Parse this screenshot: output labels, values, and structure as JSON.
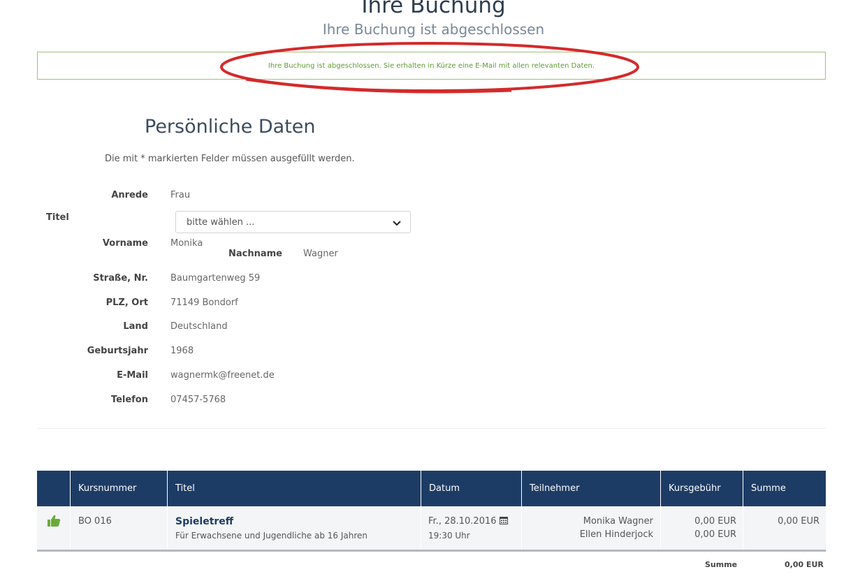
{
  "header": {
    "title": "Ihre Buchung",
    "subtitle": "Ihre Buchung ist abgeschlossen"
  },
  "alert": {
    "message": "Ihre Buchung ist abgeschlossen. Sie erhalten in Kürze eine E-Mail mit allen relevanten Daten."
  },
  "personal": {
    "section_title": "Persönliche Daten",
    "hint": "Die mit * markierten Felder müssen ausgefüllt werden.",
    "anrede_label": "Anrede",
    "anrede_value": "Frau",
    "titel_label": "Titel",
    "titel_select": "bitte wählen ...",
    "vorname_label": "Vorname",
    "vorname_value": "Monika",
    "nachname_label": "Nachname",
    "nachname_value": "Wagner",
    "strasse_label": "Straße, Nr.",
    "strasse_value": "Baumgartenweg 59",
    "plz_label": "PLZ, Ort",
    "plz_value": "71149 Bondorf",
    "land_label": "Land",
    "land_value": "Deutschland",
    "geburtsjahr_label": "Geburtsjahr",
    "geburtsjahr_value": "1968",
    "email_label": "E-Mail",
    "email_value": "wagnermk@freenet.de",
    "telefon_label": "Telefon",
    "telefon_value": "07457-5768"
  },
  "table": {
    "columns": [
      "",
      "Kursnummer",
      "Titel",
      "Datum",
      "Teilnehmer",
      "Kursgebühr",
      "Summe"
    ],
    "row": {
      "kursnummer": "BO 016",
      "titel": "Spieletreff",
      "beschreibung": "Für Erwachsene und Jugendliche ab 16 Jahren",
      "datum": "Fr., 28.10.2016",
      "uhrzeit": "19:30 Uhr",
      "teilnehmer": [
        "Monika Wagner",
        "Ellen Hinderjock"
      ],
      "gebuehren": [
        "0,00 EUR",
        "0,00 EUR"
      ],
      "summe": "0,00 EUR"
    },
    "total_label": "Summe",
    "total_value": "0,00 EUR"
  },
  "colors": {
    "table_header": "#1d3c65",
    "alert_border": "#9fc07a",
    "alert_text": "#5f9a34",
    "ellipse": "#d42a2a",
    "thumb": "#6aaa3a"
  },
  "icons": {
    "status": "thumbs-up-icon",
    "calendar": "calendar-icon",
    "select": "chevron-down-icon"
  }
}
